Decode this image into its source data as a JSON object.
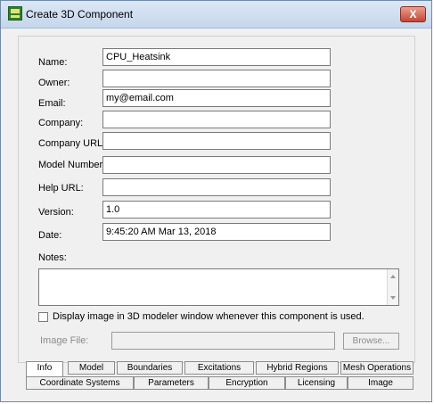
{
  "window": {
    "title": "Create 3D Component",
    "close_label": "X"
  },
  "form": {
    "name_label": "Name:",
    "name_value": "CPU_Heatsink",
    "owner_label": "Owner:",
    "owner_value": "",
    "email_label": "Email:",
    "email_value": "my@email.com",
    "company_label": "Company:",
    "company_value": "",
    "company_url_label": "Company URL:",
    "company_url_value": "",
    "model_number_label": "Model Number:",
    "model_number_value": "",
    "help_url_label": "Help URL:",
    "help_url_value": "",
    "version_label": "Version:",
    "version_value": "1.0",
    "date_label": "Date:",
    "date_value": "9:45:20 AM  Mar 13, 2018",
    "notes_label": "Notes:",
    "notes_value": "",
    "display_image_label": "Display image in 3D modeler window whenever this component is used.",
    "display_image_checked": false,
    "image_file_label": "Image File:",
    "image_file_value": "",
    "browse_label": "Browse..."
  },
  "tabs": {
    "row1": [
      "Info",
      "Model",
      "Boundaries",
      "Excitations",
      "Hybrid Regions",
      "Mesh Operations"
    ],
    "row2": [
      "Coordinate Systems",
      "Parameters",
      "Encryption",
      "Licensing",
      "Image"
    ],
    "active": "Info"
  },
  "icons": {
    "app": "hfss-app-icon",
    "close": "close-icon",
    "scroll_up": "scroll-up-arrow-icon",
    "scroll_down": "scroll-down-arrow-icon"
  }
}
